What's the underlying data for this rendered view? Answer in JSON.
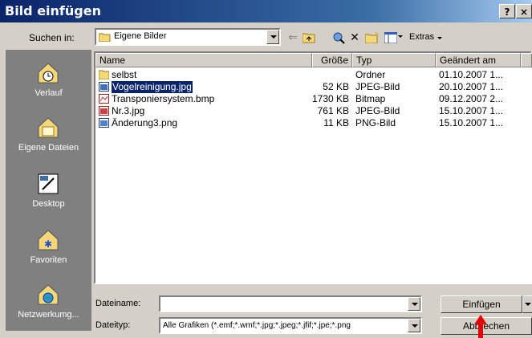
{
  "window": {
    "title": "Bild einfügen",
    "help_label": "?",
    "close_label": "×"
  },
  "search": {
    "label": "Suchen in:",
    "location": "Eigene Bilder",
    "extras_label": "Extras"
  },
  "places": [
    {
      "label": "Verlauf",
      "icon": "history-icon"
    },
    {
      "label": "Eigene Dateien",
      "icon": "my-documents-icon"
    },
    {
      "label": "Desktop",
      "icon": "desktop-icon"
    },
    {
      "label": "Favoriten",
      "icon": "favorites-icon"
    },
    {
      "label": "Netzwerkumg...",
      "icon": "network-icon"
    }
  ],
  "columns": {
    "name": "Name",
    "size": "Größe",
    "type": "Typ",
    "modified": "Geändert am"
  },
  "files": [
    {
      "name": "selbst",
      "size": "",
      "type": "Ordner",
      "modified": "01.10.2007 1...",
      "icon": "folder-icon",
      "selected": false
    },
    {
      "name": "Vogelreinigung.jpg",
      "size": "52 KB",
      "type": "JPEG-Bild",
      "modified": "20.10.2007 1...",
      "icon": "image-icon",
      "selected": true
    },
    {
      "name": "Transponiersystem.bmp",
      "size": "1730 KB",
      "type": "Bitmap",
      "modified": "09.12.2007 2...",
      "icon": "bitmap-icon",
      "selected": false
    },
    {
      "name": "Nr.3.jpg",
      "size": "761 KB",
      "type": "JPEG-Bild",
      "modified": "15.10.2007 1...",
      "icon": "image-icon",
      "selected": false
    },
    {
      "name": "Änderung3.png",
      "size": "11 KB",
      "type": "PNG-Bild",
      "modified": "15.10.2007 1...",
      "icon": "image-icon",
      "selected": false
    }
  ],
  "filename": {
    "label": "Dateiname:",
    "value": ""
  },
  "filetype": {
    "label": "Dateityp:",
    "value": "Alle Grafiken (*.emf;*.wmf;*.jpg;*.jpeg;*.jfif;*.jpe;*.png"
  },
  "buttons": {
    "insert": "Einfügen",
    "cancel": "Abbrechen"
  },
  "colors": {
    "title_start": "#0a246a",
    "title_end": "#a6caf0",
    "selection": "#0a246a",
    "places_bg": "#808080",
    "pointer": "#e00000"
  }
}
